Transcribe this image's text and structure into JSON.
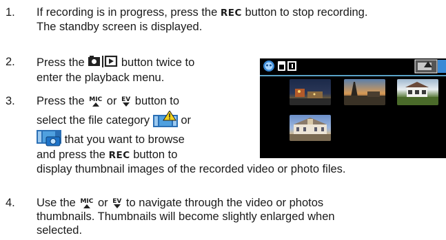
{
  "steps": [
    {
      "num": "1.",
      "line1_a": "If recording is in progress, press the ",
      "line1_btn": "REC",
      "line1_b": " button to stop recording.",
      "line2": "The standby screen is displayed."
    },
    {
      "num": "2.",
      "line1_a": "Press the ",
      "line1_b": " button twice to",
      "line2": "enter the playback menu."
    },
    {
      "num": "3.",
      "line1_a": "Press the ",
      "line1_or": " or ",
      "line1_b": " button to",
      "line2_a": "select the file category ",
      "line2_b": " or",
      "line3": " that you want to browse",
      "line4_a": "and press the ",
      "line4_btn": "REC",
      "line4_b": " button to",
      "line5": "display thumbnail images of the recorded video or photo files."
    },
    {
      "num": "4.",
      "line1_a": "Use the ",
      "line1_or": " or ",
      "line1_b": " to navigate through the video or photos",
      "line2": "thumbnails. Thumbnails will become slightly enlarged when",
      "line3": "selected."
    }
  ],
  "icons": {
    "mic_label": "MIC",
    "ev_label": "EV"
  },
  "colors": {
    "screen_bg": "#000000",
    "screen_line": "#5aa3c8",
    "text": "#1a1a1a"
  }
}
